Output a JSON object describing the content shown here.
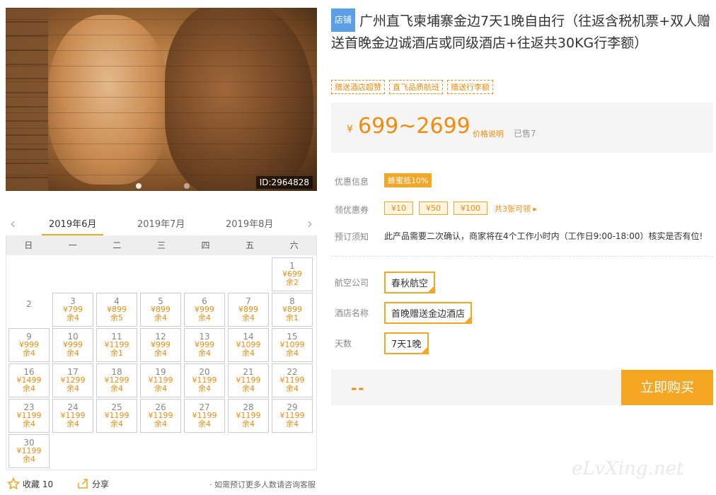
{
  "photo": {
    "id_tag": "ID:2964828"
  },
  "months": {
    "tabs": [
      "2019年6月",
      "2019年7月",
      "2019年8月"
    ]
  },
  "weekdays": [
    "日",
    "一",
    "二",
    "三",
    "四",
    "五",
    "六"
  ],
  "calendar": {
    "days": [
      null,
      null,
      null,
      null,
      null,
      null,
      {
        "day": "1",
        "price": "¥699",
        "stock": "余2"
      },
      {
        "day": "2"
      },
      {
        "day": "3",
        "price": "¥799",
        "stock": "余4"
      },
      {
        "day": "4",
        "price": "¥899",
        "stock": "余5"
      },
      {
        "day": "5",
        "price": "¥899",
        "stock": "余4"
      },
      {
        "day": "6",
        "price": "¥999",
        "stock": "余4"
      },
      {
        "day": "7",
        "price": "¥899",
        "stock": "余4"
      },
      {
        "day": "8",
        "price": "¥899",
        "stock": "余1"
      },
      {
        "day": "9",
        "price": "¥999",
        "stock": "余4"
      },
      {
        "day": "10",
        "price": "¥999",
        "stock": "余4"
      },
      {
        "day": "11",
        "price": "¥1199",
        "stock": "余1"
      },
      {
        "day": "12",
        "price": "¥999",
        "stock": "余4"
      },
      {
        "day": "13",
        "price": "¥999",
        "stock": "余4"
      },
      {
        "day": "14",
        "price": "¥1099",
        "stock": "余4"
      },
      {
        "day": "15",
        "price": "¥1099",
        "stock": "余4"
      },
      {
        "day": "16",
        "price": "¥1499",
        "stock": "余4"
      },
      {
        "day": "17",
        "price": "¥1299",
        "stock": "余4"
      },
      {
        "day": "18",
        "price": "¥1299",
        "stock": "余4"
      },
      {
        "day": "19",
        "price": "¥1199",
        "stock": "余4"
      },
      {
        "day": "20",
        "price": "¥1199",
        "stock": "余4"
      },
      {
        "day": "21",
        "price": "¥1199",
        "stock": "余4"
      },
      {
        "day": "22",
        "price": "¥1199",
        "stock": "余4"
      },
      {
        "day": "23",
        "price": "¥1199",
        "stock": "余4"
      },
      {
        "day": "24",
        "price": "¥1199",
        "stock": "余4"
      },
      {
        "day": "25",
        "price": "¥1199",
        "stock": "余4"
      },
      {
        "day": "26",
        "price": "¥1199",
        "stock": "余4"
      },
      {
        "day": "27",
        "price": "¥1199",
        "stock": "余4"
      },
      {
        "day": "28",
        "price": "¥1199",
        "stock": "余4"
      },
      {
        "day": "29",
        "price": "¥1199",
        "stock": "余4"
      },
      {
        "day": "30",
        "price": "¥1199",
        "stock": "余4"
      }
    ]
  },
  "bottom": {
    "fav_label": "收藏 10",
    "share_label": "分享",
    "note": "· 如需预订更多人数请咨询客服"
  },
  "product": {
    "badge": "店铺",
    "title": "广州直飞柬埔寨金边7天1晚自由行（往返含税机票+双人赠送首晚金边诚酒店或同级酒店+往返共30KG行李额）",
    "tags": [
      "赠送酒店超赞",
      "直飞品质航班",
      "赠送行李额"
    ],
    "price_symbol": "¥",
    "price": "699~2699",
    "price_desc": "价格说明",
    "sold": "已售7"
  },
  "info": {
    "discount_label": "优惠信息",
    "discount_value": "蜂蜜抵10%",
    "coupon_label": "领优惠券",
    "coupons": [
      "¥10",
      "¥50",
      "¥100"
    ],
    "coupon_more": "共3张可领 ▸",
    "notice_label": "预订须知",
    "notice_text": "此产品需要二次确认，商家将在4个工作小时内（工作日9:00-18:00）核实是否有位!"
  },
  "options": {
    "airline_label": "航空公司",
    "airline": "春秋航空",
    "hotel_label": "酒店名称",
    "hotel": "首晚赠送金边酒店",
    "days_label": "天数",
    "days": "7天1晚"
  },
  "buy": {
    "total": "--",
    "button": "立即购买"
  },
  "watermark": "eLvXing.net",
  "colors": {
    "accent": "#f5a623",
    "price": "#f28b0c",
    "badge": "#5b9fe8"
  }
}
